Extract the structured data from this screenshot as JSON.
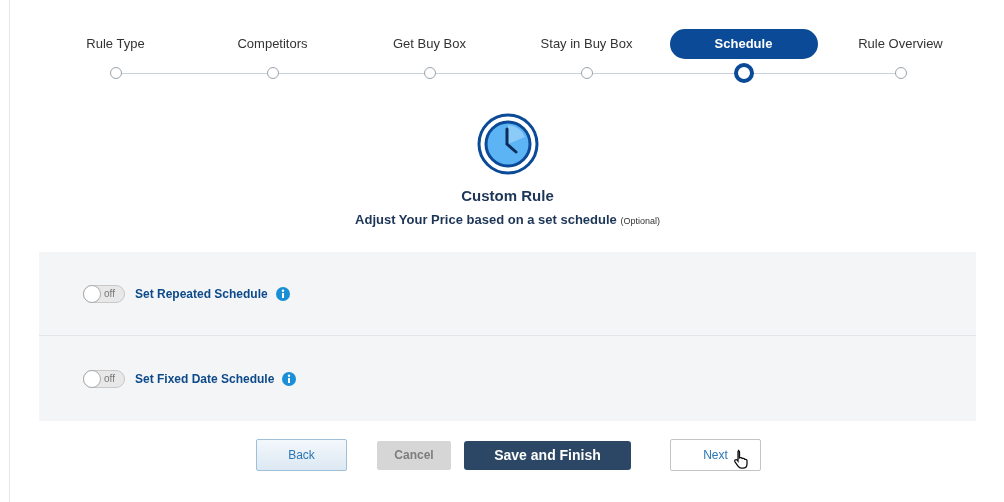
{
  "steps": [
    {
      "label": "Rule Type",
      "selected": false
    },
    {
      "label": "Competitors",
      "selected": false
    },
    {
      "label": "Get Buy Box",
      "selected": false
    },
    {
      "label": "Stay in Buy Box",
      "selected": false
    },
    {
      "label": "Schedule",
      "selected": true
    },
    {
      "label": "Rule Overview",
      "selected": false
    }
  ],
  "heading": {
    "title": "Custom Rule",
    "subtitle": "Adjust Your Price based on a set schedule",
    "note": "(Optional)"
  },
  "schedules": [
    {
      "label": "Set Repeated Schedule",
      "on": false,
      "toggle_text": "off"
    },
    {
      "label": "Set Fixed Date Schedule",
      "on": false,
      "toggle_text": "off"
    }
  ],
  "buttons": [
    {
      "label": "Back",
      "kind": "secondary",
      "disabled": false
    },
    {
      "label": "Cancel",
      "kind": "secondary",
      "disabled": true
    },
    {
      "label": "Save and Finish",
      "kind": "primary",
      "disabled": false
    },
    {
      "label": "Next",
      "kind": "outline",
      "disabled": false
    }
  ]
}
